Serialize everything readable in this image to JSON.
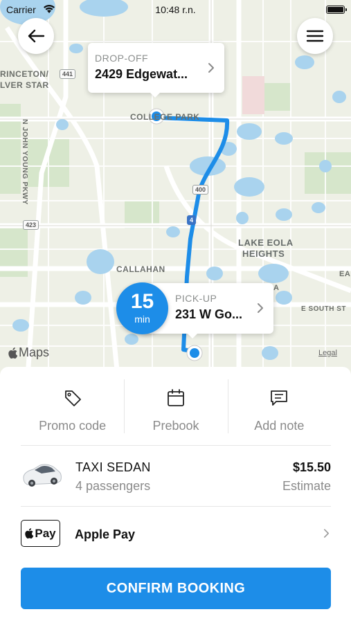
{
  "status_bar": {
    "carrier": "Carrier",
    "time": "10:48 r.n."
  },
  "map": {
    "labels": {
      "princeton": "RINCETON/",
      "silver_star": "LVER STAR",
      "college_park": "COLLEGE PARK",
      "john_young": "N JOHN YOUNG PKWY",
      "lake_eola": "LAKE EOLA",
      "heights": "HEIGHTS",
      "callahan": "CALLAHAN",
      "south_st": "E SOUTH ST",
      "ea": "EA",
      "a": "A"
    },
    "shields": {
      "r441": "441",
      "r400": "400",
      "r423": "423",
      "r4": "4"
    },
    "attribution": {
      "brand": "Maps",
      "legal": "Legal"
    }
  },
  "dropoff": {
    "caption": "DROP-OFF",
    "address": "2429 Edgewat..."
  },
  "pickup": {
    "caption": "PICK-UP",
    "address": "231 W Go..."
  },
  "eta": {
    "value": "15",
    "unit": "min"
  },
  "actions": [
    {
      "label": "Promo code",
      "icon": "tag-icon"
    },
    {
      "label": "Prebook",
      "icon": "calendar-icon"
    },
    {
      "label": "Add note",
      "icon": "message-icon"
    }
  ],
  "vehicle": {
    "name": "TAXI SEDAN",
    "capacity": "4 passengers",
    "price": "$15.50",
    "price_note": "Estimate"
  },
  "payment": {
    "badge_text": "Pay",
    "method": "Apple Pay"
  },
  "confirm_label": "CONFIRM BOOKING",
  "colors": {
    "accent": "#1d8de8",
    "water": "#a9d3ee",
    "park": "#cfe3c2",
    "route": "#1d8de8"
  }
}
